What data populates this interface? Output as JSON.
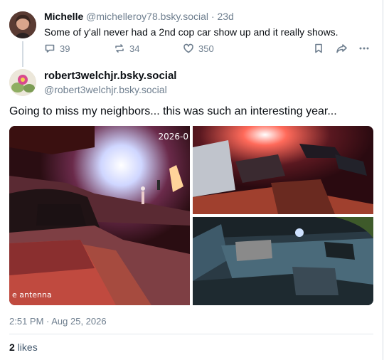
{
  "parent_post": {
    "author_name": "Michelle",
    "author_handle": "@michelleroy78.bsky.social",
    "age": "· 23d",
    "text": "Some of y'all never had a 2nd cop car show up and it really shows.",
    "replies": "39",
    "reposts": "34",
    "likes": "350"
  },
  "main_post": {
    "author_name": "robert3welchjr.bsky.social",
    "author_handle": "@robert3welchjr.bsky.social",
    "text": "Going to miss my neighbors... this was such an interesting year...",
    "image1_timestamp": "2026-0",
    "image1_watermark": "e  antenna",
    "timestamp": "2:51 PM · Aug 25, 2026",
    "like_count": "2",
    "like_label": "likes"
  },
  "icons": [
    "reply-icon",
    "repost-icon",
    "heart-icon",
    "bookmark-icon",
    "share-icon",
    "more-icon"
  ],
  "colors": {
    "muted": "#6f7f8f",
    "border": "#d4dbe2"
  }
}
